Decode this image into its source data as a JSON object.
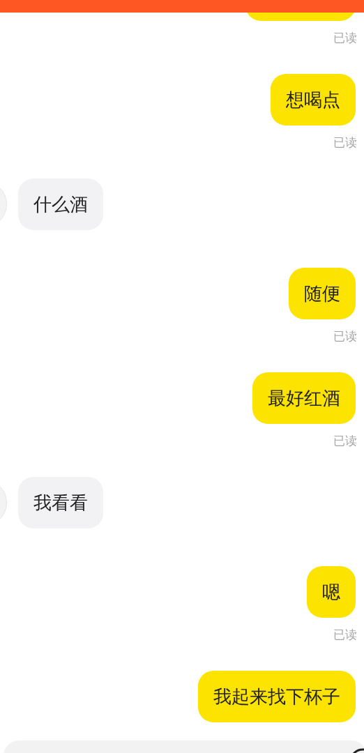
{
  "header": {
    "kind": "bar"
  },
  "messages": [
    {
      "kind": "sent",
      "status": "已读"
    },
    {
      "kind": "sent",
      "text": "想喝点",
      "status": "已读"
    },
    {
      "kind": "received",
      "text": "什么酒"
    },
    {
      "kind": "sent",
      "text": "随便",
      "status": "已读"
    },
    {
      "kind": "sent",
      "text": "最好红酒",
      "status": "已读"
    },
    {
      "kind": "received",
      "text": "我看看"
    },
    {
      "kind": "sent",
      "text": "嗯",
      "status": "已读"
    },
    {
      "kind": "sent",
      "text": "我起来找下杯子"
    }
  ],
  "input_bar": {
    "kind": "text"
  }
}
